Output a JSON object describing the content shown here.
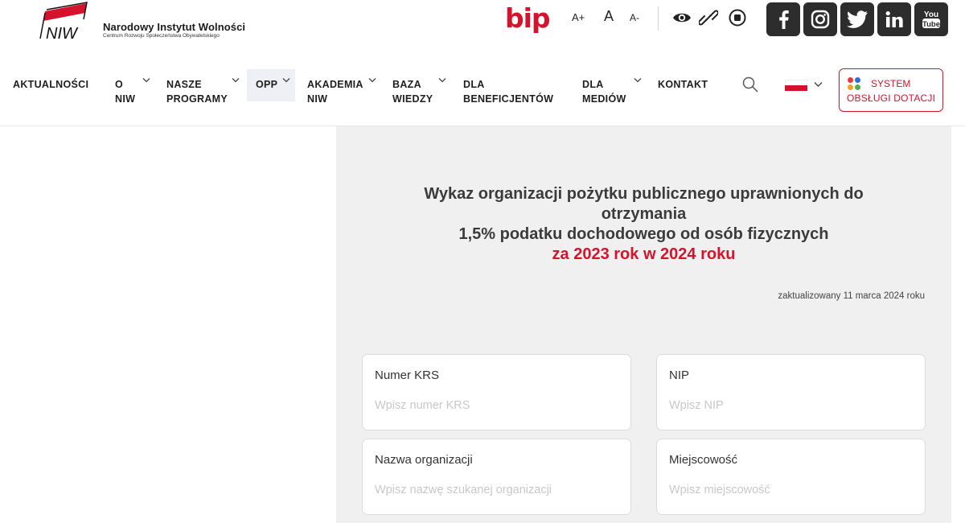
{
  "header": {
    "org_name": "Narodowy Instytut Wolności",
    "org_subtitle": "Centrum Rozwoju Społeczeństwa Obywatelskiego",
    "logo_text": "NIW",
    "bip_label": "bip",
    "font_size_buttons": [
      "A+",
      "A",
      "A-"
    ],
    "icons": [
      "eye-icon",
      "link-icon",
      "stop-icon"
    ],
    "social": [
      "facebook-icon",
      "instagram-icon",
      "twitter-icon",
      "linkedin-icon",
      "youtube-icon"
    ]
  },
  "nav": {
    "items": [
      {
        "line1": "AKTUALNOŚCI",
        "line2": ""
      },
      {
        "line1": "O",
        "line2": "NIW"
      },
      {
        "line1": "NASZE",
        "line2": "PROGRAMY"
      },
      {
        "line1": "OPP",
        "line2": ""
      },
      {
        "line1": "AKADEMIA",
        "line2": "NIW"
      },
      {
        "line1": "BAZA",
        "line2": "WIEDZY"
      },
      {
        "line1": "DLA",
        "line2": "BENEFICJENTÓW"
      },
      {
        "line1": "DLA",
        "line2": "MEDIÓW"
      },
      {
        "line1": "KONTAKT",
        "line2": ""
      }
    ],
    "active": "OPP",
    "sod_line1": "SYSTEM",
    "sod_line2": "OBSŁUGI DOTACJI",
    "sod_dot_colors": [
      "#e8373d",
      "#2d6fd1",
      "#f2a51a",
      "#4caf50"
    ]
  },
  "main": {
    "heading_line1": "Wykaz organizacji pożytku publicznego uprawnionych do",
    "heading_line2": "otrzymania",
    "heading_line3": "1,5% podatku dochodowego od osób fizycznych",
    "heading_line4": "za 2023 rok w 2024 roku",
    "updated": "zaktualizowany 11 marca 2024 roku",
    "fields": {
      "krs": {
        "label": "Numer KRS",
        "placeholder": "Wpisz numer KRS",
        "value": ""
      },
      "nip": {
        "label": "NIP",
        "placeholder": "Wpisz NIP",
        "value": ""
      },
      "name": {
        "label": "Nazwa organizacji",
        "placeholder": "Wpisz nazwę szukanej organizacji",
        "value": ""
      },
      "city": {
        "label": "Miejscowość",
        "placeholder": "Wpisz miejscowość",
        "value": ""
      }
    }
  },
  "colors": {
    "accent": "#d5132c",
    "panel_bg": "#f0f0f1",
    "social_bg": "#2d2d2d",
    "active_nav_bg": "#eef0f5"
  }
}
